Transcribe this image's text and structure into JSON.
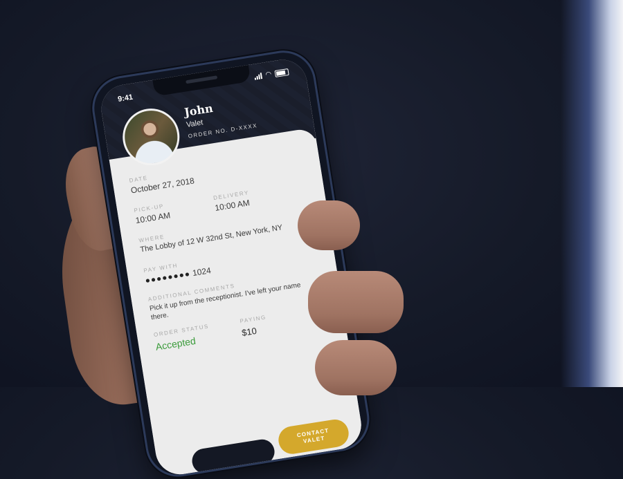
{
  "status_bar": {
    "time": "9:41"
  },
  "profile": {
    "name": "John",
    "role": "Valet",
    "order_no": "ORDER NO. D-XXXX"
  },
  "details": {
    "date_label": "DATE",
    "date": "October 27, 2018",
    "pickup_label": "PICK-UP",
    "pickup": "10:00 AM",
    "delivery_label": "DELIVERY",
    "delivery": "10:00 AM",
    "where_label": "WHERE",
    "where": "The Lobby of 12 W 32nd St, New York, NY",
    "pay_label": "PAY WITH",
    "pay_dots": "●●●●●●●●",
    "pay_last4": "1024",
    "comments_label": "ADDITIONAL COMMENTS",
    "comments": "Pick it up from the receptionist. I've left your name there.",
    "status_label": "ORDER STATUS",
    "status": "Accepted",
    "paying_label": "PAYING",
    "paying": "$10"
  },
  "actions": {
    "contact_label": "CONTACT\nVALET"
  },
  "colors": {
    "accent": "#d4a82c",
    "status_green": "#3a9b3a",
    "header": "#1c2130"
  }
}
